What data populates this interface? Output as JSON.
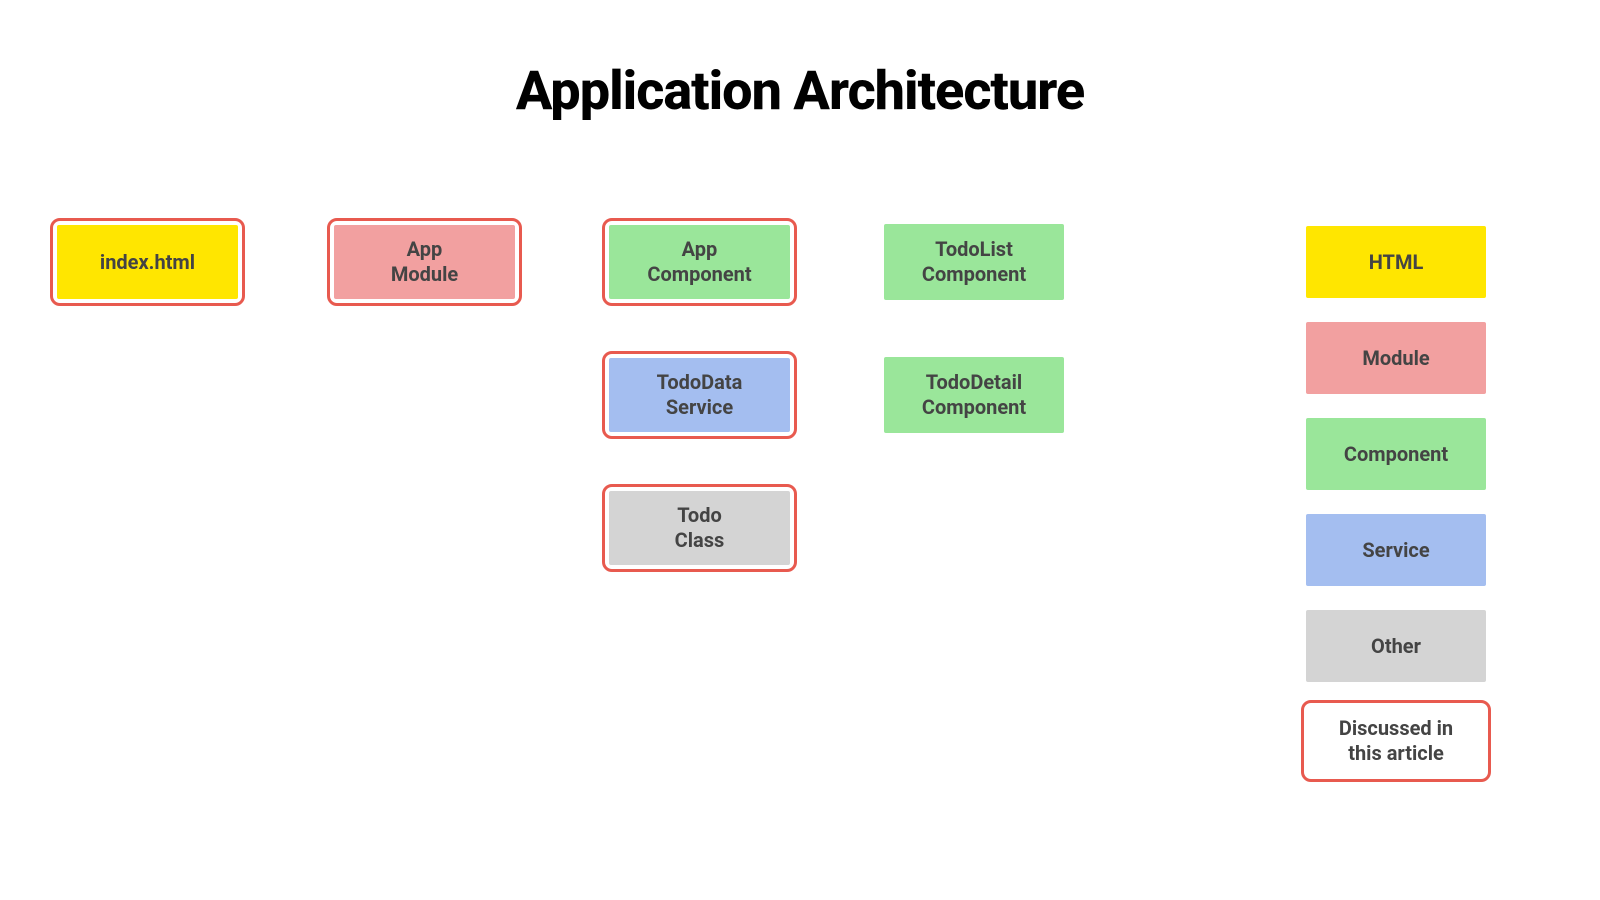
{
  "title": "Application Architecture",
  "colors": {
    "yellow": "#ffe600",
    "pink": "#f2a0a0",
    "green": "#9ae69a",
    "blue": "#a4bef0",
    "gray": "#d4d4d4",
    "highlight_border": "#e85a4f"
  },
  "nodes": {
    "index_html": {
      "line1": "index.html",
      "highlighted": true,
      "type": "html"
    },
    "app_module": {
      "line1": "App",
      "line2": "Module",
      "highlighted": true,
      "type": "module"
    },
    "app_component": {
      "line1": "App",
      "line2": "Component",
      "highlighted": true,
      "type": "component"
    },
    "todolist_component": {
      "line1": "TodoList",
      "line2": "Component",
      "highlighted": false,
      "type": "component"
    },
    "tododata_service": {
      "line1": "TodoData",
      "line2": "Service",
      "highlighted": true,
      "type": "service"
    },
    "tododetail_component": {
      "line1": "TodoDetail",
      "line2": "Component",
      "highlighted": false,
      "type": "component"
    },
    "todo_class": {
      "line1": "Todo",
      "line2": "Class",
      "highlighted": true,
      "type": "other"
    }
  },
  "legend": {
    "html": "HTML",
    "module": "Module",
    "component": "Component",
    "service": "Service",
    "other": "Other",
    "discussed_line1": "Discussed in",
    "discussed_line2": "this article"
  }
}
